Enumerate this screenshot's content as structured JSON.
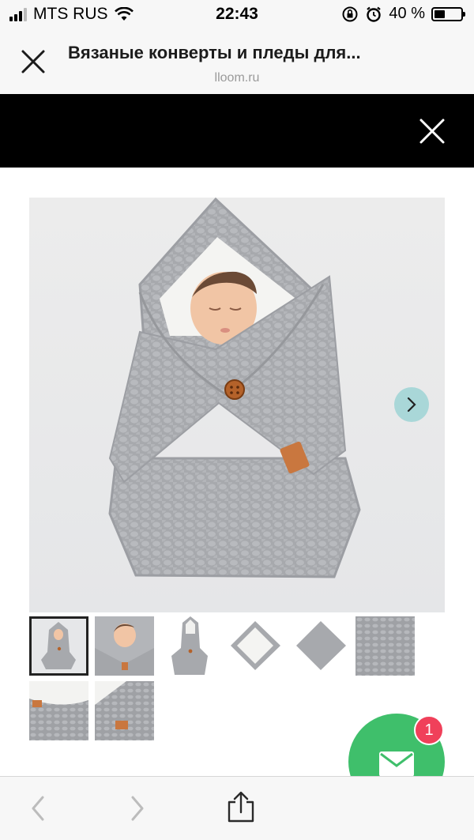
{
  "status": {
    "carrier": "MTS RUS",
    "time": "22:43",
    "battery_label": "40 %",
    "battery_level": 0.4
  },
  "header": {
    "title": "Вязаные конверты и пледы для...",
    "domain": "lloom.ru"
  },
  "gallery": {
    "thumbnails": [
      "thumb-1",
      "thumb-2",
      "thumb-3",
      "thumb-4",
      "thumb-5",
      "thumb-6",
      "thumb-7",
      "thumb-8"
    ],
    "active_index": 0
  },
  "chat": {
    "badge_count": "1"
  },
  "colors": {
    "chat_green": "#3fbf6b",
    "badge_red": "#f0405a",
    "arrow_teal": "#a9d7d8"
  }
}
